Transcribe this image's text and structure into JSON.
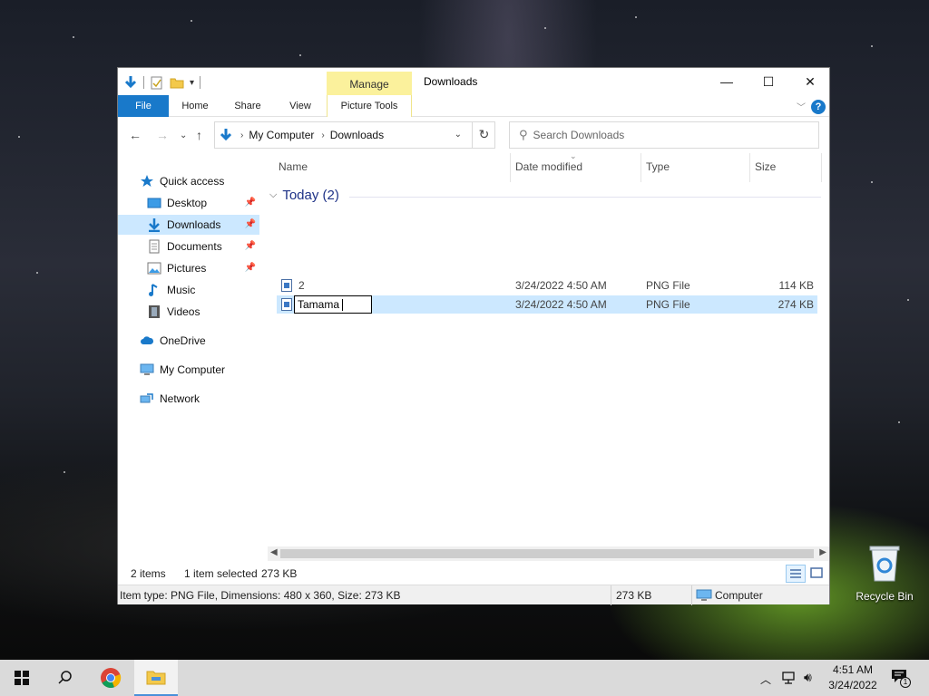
{
  "window": {
    "title": "Downloads",
    "manage_tab": "Manage",
    "controls": {
      "minimize": "—",
      "maximize": "☐",
      "close": "✕"
    }
  },
  "ribbon": {
    "tabs": [
      "File",
      "Home",
      "Share",
      "View",
      "Picture Tools"
    ],
    "help": "?"
  },
  "address": {
    "crumbs": [
      "My Computer",
      "Downloads"
    ],
    "search_placeholder": "Search Downloads"
  },
  "sidebar": {
    "items": [
      {
        "label": "Quick access",
        "icon": "star-icon"
      },
      {
        "label": "Desktop",
        "icon": "desktop-icon",
        "pinned": true
      },
      {
        "label": "Downloads",
        "icon": "download-icon",
        "pinned": true,
        "selected": true
      },
      {
        "label": "Documents",
        "icon": "documents-icon",
        "pinned": true
      },
      {
        "label": "Pictures",
        "icon": "pictures-icon",
        "pinned": true
      },
      {
        "label": "Music",
        "icon": "music-icon"
      },
      {
        "label": "Videos",
        "icon": "videos-icon"
      },
      {
        "label": "OneDrive",
        "icon": "cloud-icon"
      },
      {
        "label": "My Computer",
        "icon": "computer-icon"
      },
      {
        "label": "Network",
        "icon": "network-icon"
      }
    ]
  },
  "columns": [
    "Name",
    "Date modified",
    "Type",
    "Size"
  ],
  "group": {
    "label": "Today (2)"
  },
  "files": [
    {
      "name": "2",
      "date": "3/24/2022 4:50 AM",
      "type": "PNG File",
      "size": "114 KB",
      "selected": false
    },
    {
      "name": "Tamama",
      "date": "3/24/2022 4:50 AM",
      "type": "PNG File",
      "size": "274 KB",
      "selected": true,
      "renaming": true
    }
  ],
  "status": {
    "items": "2 items",
    "selected": "1 item selected",
    "size": "273 KB"
  },
  "details": {
    "info": "Item type: PNG File, Dimensions: 480 x 360, Size: 273 KB",
    "size": "273 KB",
    "location": "Computer"
  },
  "desktop": {
    "recycle_bin": "Recycle Bin"
  },
  "taskbar": {
    "time": "4:51 AM",
    "date": "3/24/2022",
    "notifications": "1"
  },
  "colors": {
    "accent": "#1979ca",
    "selection": "#cce8ff",
    "manage_tab": "#fbf19c",
    "group_heading": "#1e3287"
  }
}
